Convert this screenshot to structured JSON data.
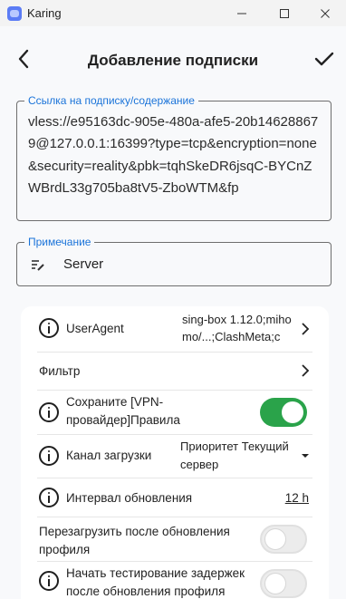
{
  "window": {
    "title": "Karing",
    "minimize_icon": "minimize-icon",
    "maximize_icon": "maximize-icon",
    "close_icon": "close-icon"
  },
  "header": {
    "title": "Добавление подписки",
    "back_icon": "chevron-left-icon",
    "confirm_icon": "check-icon"
  },
  "url_field": {
    "label": "Ссылка на подписку/содержание",
    "value": "vless://e95163dc-905e-480a-afe5-20b146288679@127.0.0.1:16399?type=tcp&encryption=none&security=reality&pbk=tqhSkeDR6jsqC-BYCnZWBrdL33g705ba8tV5-ZboWTM&fp"
  },
  "note_field": {
    "label": "Примечание",
    "value": "Server",
    "icon": "edit-note-icon"
  },
  "settings": {
    "user_agent": {
      "label": "UserAgent",
      "value": "sing-box 1.12.0;mihomo/...;ClashMeta;c"
    },
    "filter": {
      "label": "Фильтр"
    },
    "save_rules": {
      "label": "Сохраните [VPN-провайдер]Правила",
      "enabled": true
    },
    "download_channel": {
      "label": "Канал загрузки",
      "value": "Приоритет Текущий сервер"
    },
    "update_interval": {
      "label": "Интервал обновления",
      "value": "12 h"
    },
    "reload_after_update": {
      "label": "Перезагрузить после обновления профиля",
      "enabled": false
    },
    "latency_test_after_update": {
      "label": "Начать тестирование задержек после обновления профиля",
      "enabled": false
    }
  },
  "colors": {
    "accent": "#1a73d9",
    "toggle_on": "#2aa34a",
    "background": "#f8f9fb",
    "card": "#ffffff"
  }
}
